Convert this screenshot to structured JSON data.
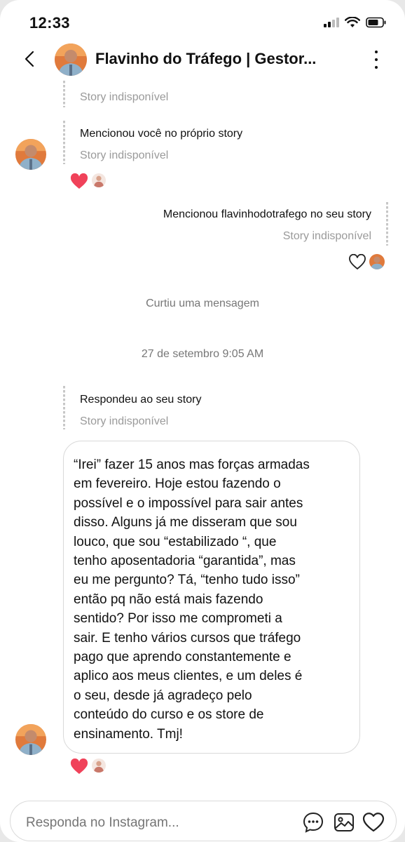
{
  "status_bar": {
    "time": "12:33"
  },
  "header": {
    "title": "Flavinho do Tráfego | Gestor...",
    "back_icon": "chevron-left-icon",
    "more_icon": "more-vertical-icon"
  },
  "thread": {
    "top_story_status": "Story indisponível",
    "incoming_mention": {
      "label": "Mencionou você no próprio story",
      "status": "Story indisponível"
    },
    "outgoing_mention": {
      "label": "Mencionou flavinhodotrafego no seu story",
      "status": "Story indisponível"
    },
    "liked_notice": "Curtiu uma mensagem",
    "timestamp": "27 de setembro 9:05 AM",
    "story_reply": {
      "label": "Respondeu ao seu story",
      "status": "Story indisponível"
    },
    "message_lines": [
      "“Irei” fazer 15 anos mas forças armadas",
      "em fevereiro. Hoje estou fazendo o",
      "possível e o impossível para sair antes",
      "disso. Alguns já me disseram que sou",
      "louco, que sou “estabilizado “, que",
      "tenho aposentadoria “garantida”, mas",
      "eu me pergunto? Tá, “tenho tudo isso”",
      "então pq não está mais fazendo",
      "sentido? Por isso me comprometi a",
      "sair. E tenho vários cursos que tráfego",
      "pago que aprendo constantemente e",
      "aplico aos meus clientes, e um deles é",
      "o seu, desde já agradeço pelo",
      "conteúdo do curso e os store de",
      "ensinamento. Tmj!"
    ]
  },
  "composer": {
    "placeholder": "Responda no Instagram...",
    "icons": [
      "sticker-chat-icon",
      "gallery-icon",
      "heart-icon"
    ]
  },
  "colors": {
    "reaction_heart": "#f0425a",
    "bubble_border": "#d9d9d9",
    "secondary_text": "#9a9a9a"
  }
}
